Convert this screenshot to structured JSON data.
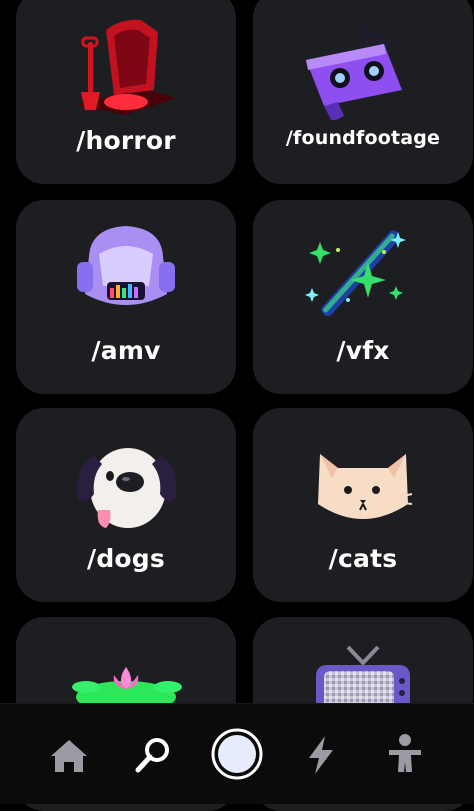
{
  "feeds": [
    {
      "label": "/horror",
      "icon": "haunted-grave-icon"
    },
    {
      "label": "/foundfootage",
      "icon": "vhs-tape-icon"
    },
    {
      "label": "/amv",
      "icon": "robot-helmet-icon"
    },
    {
      "label": "/vfx",
      "icon": "magic-wand-icon"
    },
    {
      "label": "/dogs",
      "icon": "dog-face-icon"
    },
    {
      "label": "/cats",
      "icon": "cat-face-icon"
    },
    {
      "label": "",
      "icon": "lily-pad-icon"
    },
    {
      "label": "",
      "icon": "retro-tv-icon"
    }
  ],
  "nav": {
    "items": [
      "home-icon",
      "search-icon",
      "record-icon",
      "lightning-icon",
      "profile-icon"
    ]
  },
  "colors": {
    "card": "#1c1e22",
    "background": "#000000",
    "nav_icon": "#9a9ba3"
  }
}
